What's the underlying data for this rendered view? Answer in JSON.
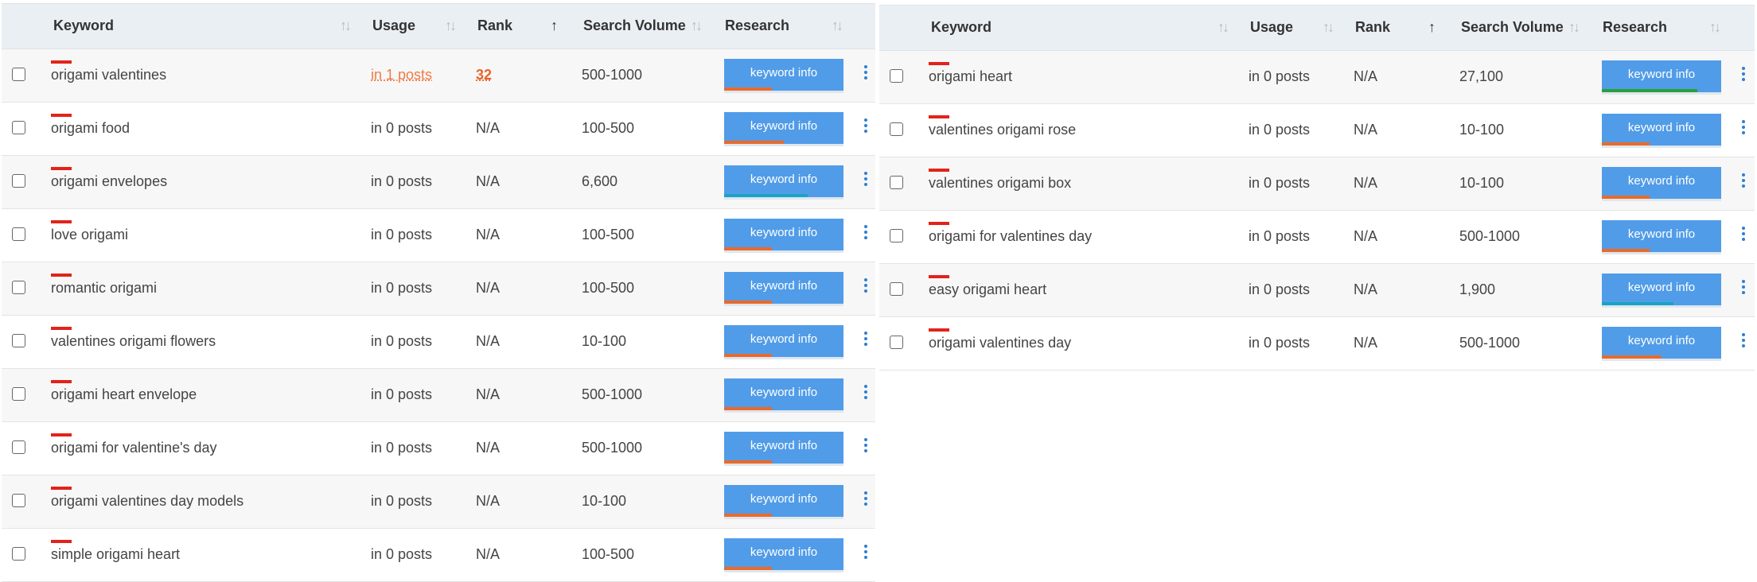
{
  "columns": {
    "keyword": "Keyword",
    "usage": "Usage",
    "rank": "Rank",
    "search_volume": "Search Volume",
    "research": "Research"
  },
  "icons": {
    "sort_idle": "↑↓",
    "sort_active": "↑",
    "keyword_marker": "red-bar-icon",
    "menu": "vertical-dots-icon"
  },
  "colors": {
    "header_bg": "#eaeff4",
    "button": "#519ce8",
    "marker": "#e2231a",
    "orange": "#f07b45",
    "teal": "#1aa3c4",
    "green": "#27a03b"
  },
  "left_rows": [
    {
      "keyword": "origami valentines",
      "usage": "in 1 posts",
      "rank": "32",
      "volume": "500-1000",
      "button": "keyword info",
      "bar": {
        "color": "#ea6a2a",
        "fill": 0.4
      }
    },
    {
      "keyword": "origami food",
      "usage": "in 0 posts",
      "rank": "N/A",
      "volume": "100-500",
      "button": "keyword info",
      "bar": {
        "color": "#ea6a2a",
        "fill": 0.5
      }
    },
    {
      "keyword": "origami envelopes",
      "usage": "in 0 posts",
      "rank": "N/A",
      "volume": "6,600",
      "button": "keyword info",
      "bar": {
        "color": "#1aa3c4",
        "fill": 0.7
      }
    },
    {
      "keyword": "love origami",
      "usage": "in 0 posts",
      "rank": "N/A",
      "volume": "100-500",
      "button": "keyword info",
      "bar": {
        "color": "#ea6a2a",
        "fill": 0.4
      }
    },
    {
      "keyword": "romantic origami",
      "usage": "in 0 posts",
      "rank": "N/A",
      "volume": "100-500",
      "button": "keyword info",
      "bar": {
        "color": "#ea6a2a",
        "fill": 0.4
      }
    },
    {
      "keyword": "valentines origami flowers",
      "usage": "in 0 posts",
      "rank": "N/A",
      "volume": "10-100",
      "button": "keyword info",
      "bar": {
        "color": "#ea6a2a",
        "fill": 0.4
      }
    },
    {
      "keyword": "origami heart envelope",
      "usage": "in 0 posts",
      "rank": "N/A",
      "volume": "500-1000",
      "button": "keyword info",
      "bar": {
        "color": "#ea6a2a",
        "fill": 0.4
      }
    },
    {
      "keyword": "origami for valentine's day",
      "usage": "in 0 posts",
      "rank": "N/A",
      "volume": "500-1000",
      "button": "keyword info",
      "bar": {
        "color": "#ea6a2a",
        "fill": 0.4
      }
    },
    {
      "keyword": "origami valentines day models",
      "usage": "in 0 posts",
      "rank": "N/A",
      "volume": "10-100",
      "button": "keyword info",
      "bar": {
        "color": "#ea6a2a",
        "fill": 0.4
      }
    },
    {
      "keyword": "simple origami heart",
      "usage": "in 0 posts",
      "rank": "N/A",
      "volume": "100-500",
      "button": "keyword info",
      "bar": {
        "color": "#ea6a2a",
        "fill": 0.4
      }
    }
  ],
  "right_rows": [
    {
      "keyword": "origami heart",
      "usage": "in 0 posts",
      "rank": "N/A",
      "volume": "27,100",
      "button": "keyword info",
      "bar": {
        "color": "#27a03b",
        "fill": 0.8
      }
    },
    {
      "keyword": "valentines origami rose",
      "usage": "in 0 posts",
      "rank": "N/A",
      "volume": "10-100",
      "button": "keyword info",
      "bar": {
        "color": "#ea6a2a",
        "fill": 0.4
      }
    },
    {
      "keyword": "valentines origami box",
      "usage": "in 0 posts",
      "rank": "N/A",
      "volume": "10-100",
      "button": "keyword info",
      "bar": {
        "color": "#ea6a2a",
        "fill": 0.4
      }
    },
    {
      "keyword": "origami for valentines day",
      "usage": "in 0 posts",
      "rank": "N/A",
      "volume": "500-1000",
      "button": "keyword info",
      "bar": {
        "color": "#ea6a2a",
        "fill": 0.4
      }
    },
    {
      "keyword": "easy origami heart",
      "usage": "in 0 posts",
      "rank": "N/A",
      "volume": "1,900",
      "button": "keyword info",
      "bar": {
        "color": "#1aa3c4",
        "fill": 0.6
      }
    },
    {
      "keyword": "origami valentines day",
      "usage": "in 0 posts",
      "rank": "N/A",
      "volume": "500-1000",
      "button": "keyword info",
      "bar": {
        "color": "#ea6a2a",
        "fill": 0.5
      }
    }
  ]
}
